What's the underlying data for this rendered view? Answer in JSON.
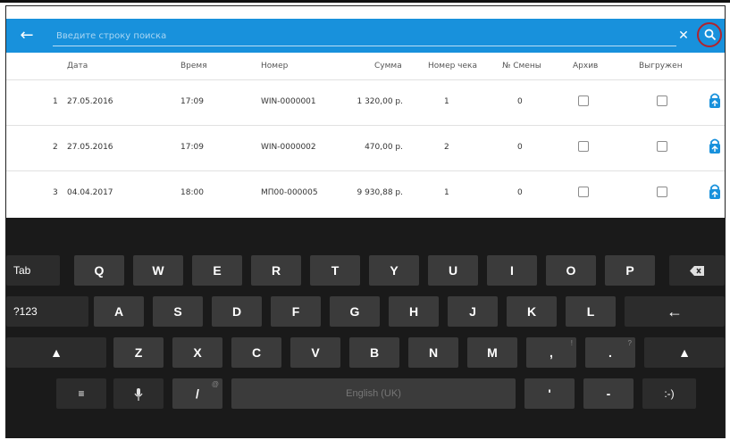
{
  "search": {
    "placeholder": "Введите строку поиска"
  },
  "table": {
    "headers": [
      "Дата",
      "Время",
      "Номер",
      "Сумма",
      "Номер чека",
      "№ Смены",
      "Архив",
      "Выгружен"
    ],
    "rows": [
      {
        "n": "1",
        "date": "27.05.2016",
        "time": "17:09",
        "number": "WIN-0000001",
        "sum": "1 320,00 р.",
        "check": "1",
        "shift": "0",
        "archived": false,
        "uploaded": false
      },
      {
        "n": "2",
        "date": "27.05.2016",
        "time": "17:09",
        "number": "WIN-0000002",
        "sum": "470,00 р.",
        "check": "2",
        "shift": "0",
        "archived": false,
        "uploaded": false
      },
      {
        "n": "3",
        "date": "04.04.2017",
        "time": "18:00",
        "number": "МП00-000005",
        "sum": "9 930,88 р.",
        "check": "1",
        "shift": "0",
        "archived": false,
        "uploaded": false
      }
    ]
  },
  "keyboard": {
    "tab": "Tab",
    "sym": "?123",
    "row1": [
      "Q",
      "W",
      "E",
      "R",
      "T",
      "Y",
      "U",
      "I",
      "O",
      "P"
    ],
    "row2": [
      "A",
      "S",
      "D",
      "F",
      "G",
      "H",
      "J",
      "K",
      "L"
    ],
    "row3": [
      "Z",
      "X",
      "C",
      "V",
      "B",
      "N",
      "M",
      ",",
      "."
    ],
    "row3_hints": {
      "comma": "!",
      "period": "?"
    },
    "slash": "/",
    "slash_hint": "@",
    "space_label": "English (UK)",
    "apostrophe": "'",
    "dash": "-",
    "smiley": ":-)"
  },
  "colors": {
    "accent": "#1891dc",
    "search_ring": "#b0242e",
    "upload_icon": "#1891dc"
  }
}
